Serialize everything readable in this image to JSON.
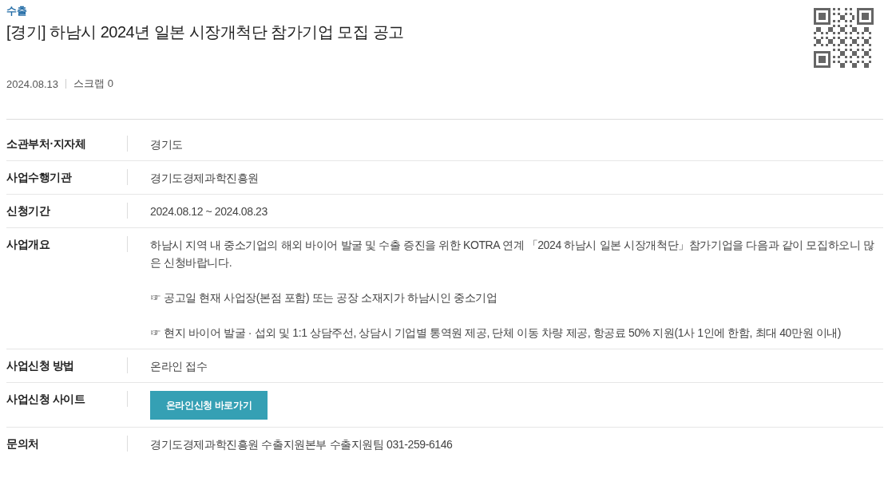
{
  "category": "수출",
  "title": "[경기] 하남시 2024년 일본 시장개척단 참가기업 모집 공고",
  "meta": {
    "date": "2024.08.13",
    "scrap": "스크랩 0"
  },
  "rows": [
    {
      "kind": "text",
      "label": "소관부처·지자체",
      "value": "경기도"
    },
    {
      "kind": "text",
      "label": "사업수행기관",
      "value": "경기도경제과학진흥원"
    },
    {
      "kind": "text",
      "label": "신청기간",
      "value": "2024.08.12 ~ 2024.08.23"
    },
    {
      "kind": "paragraphs",
      "label": "사업개요",
      "paragraphs": [
        "하남시 지역 내 중소기업의 해외 바이어 발굴 및 수출 증진을 위한 KOTRA 연계 「2024 하남시 일본 시장개척단」참가기업을 다음과 같이 모집하오니 많은 신청바랍니다.",
        "☞ 공고일 현재 사업장(본점 포함) 또는 공장 소재지가 하남시인 중소기업",
        "☞ 현지 바이어 발굴 · 섭외 및 1:1 상담주선, 상담시 기업별 통역원 제공, 단체 이동 차량 제공, 항공료 50% 지원(1사 1인에 한함, 최대 40만원 이내)"
      ]
    },
    {
      "kind": "text",
      "label": "사업신청 방법",
      "value": "온라인 접수"
    },
    {
      "kind": "button",
      "label": "사업신청 사이트",
      "button": "온라인신청 바로가기"
    },
    {
      "kind": "text",
      "label": "문의처",
      "value": "경기도경제과학진흥원 수출지원본부 수출지원팀 031-259-6146"
    }
  ]
}
